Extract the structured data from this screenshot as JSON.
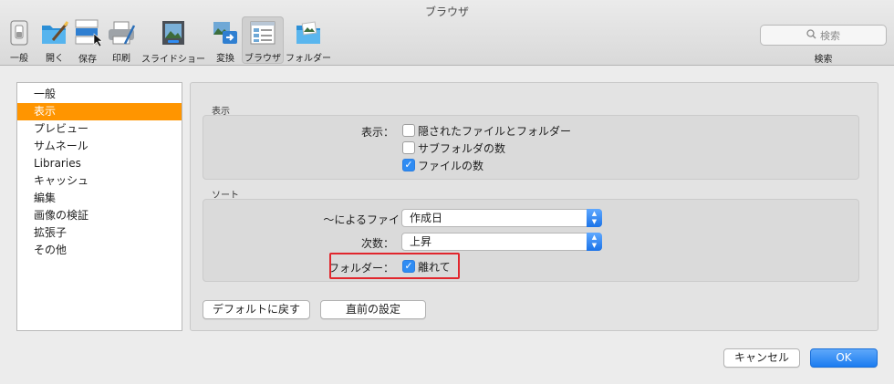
{
  "window": {
    "title": "ブラウザ"
  },
  "toolbar": {
    "items": [
      {
        "label": "一般",
        "icon": "switch-icon"
      },
      {
        "label": "開く",
        "icon": "folder-pen-icon"
      },
      {
        "label": "保存",
        "icon": "file-formats-icon",
        "badges": [
          "TIFF",
          "JPG",
          "PNG"
        ]
      },
      {
        "label": "印刷",
        "icon": "printer-icon"
      },
      {
        "label": "スライドショー",
        "icon": "slideshow-icon"
      },
      {
        "label": "変換",
        "icon": "convert-icon"
      },
      {
        "label": "ブラウザ",
        "icon": "browser-icon",
        "active": true
      },
      {
        "label": "フォルダー",
        "icon": "folder-photo-icon"
      }
    ],
    "search": {
      "placeholder": "検索",
      "label": "検索"
    }
  },
  "sidebar": {
    "items": [
      {
        "label": "一般"
      },
      {
        "label": "表示",
        "selected": true
      },
      {
        "label": "プレビュー"
      },
      {
        "label": "サムネール"
      },
      {
        "label": "Libraries"
      },
      {
        "label": "キャッシュ"
      },
      {
        "label": "編集"
      },
      {
        "label": "画像の検証"
      },
      {
        "label": "拡張子"
      },
      {
        "label": "その他"
      }
    ]
  },
  "display_section": {
    "title": "表示",
    "row_label": "表示：",
    "options": [
      {
        "label": "隠されたファイルとフォルダー",
        "checked": false
      },
      {
        "label": "サブフォルダの数",
        "checked": false
      },
      {
        "label": "ファイルの数",
        "checked": true
      }
    ]
  },
  "sort_section": {
    "title": "ソート",
    "sort_by": {
      "label": "〜によるファイ",
      "value": "作成日"
    },
    "order": {
      "label": "次数：",
      "value": "上昇"
    },
    "folders": {
      "label": "フォルダー：",
      "option": "離れて",
      "checked": true
    }
  },
  "buttons": {
    "reset_defaults": "デフォルトに戻す",
    "previous_settings": "直前の設定",
    "cancel": "キャンセル",
    "ok": "OK"
  },
  "colors": {
    "selection": "#ff9500",
    "accent": "#2f8cf3",
    "highlight_box": "#e1262d"
  }
}
